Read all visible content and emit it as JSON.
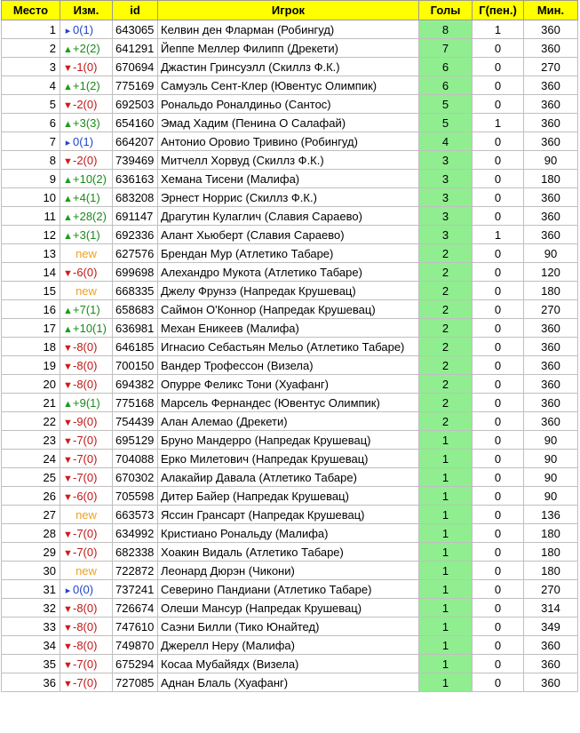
{
  "table": {
    "headers": {
      "rank": "Место",
      "change": "Изм.",
      "id": "id",
      "player": "Игрок",
      "goals": "Голы",
      "pen": "Г(пен.)",
      "min": "Мин."
    },
    "rows": [
      {
        "rank": "1",
        "dir": "same",
        "change": "0(1)",
        "id": "643065",
        "player": "Келвин ден Фларман (Робингуд)",
        "goals": "8",
        "pen": "1",
        "min": "360"
      },
      {
        "rank": "2",
        "dir": "up",
        "change": "+2(2)",
        "id": "641291",
        "player": "Йеппе Меллер Филипп (Дрекети)",
        "goals": "7",
        "pen": "0",
        "min": "360"
      },
      {
        "rank": "3",
        "dir": "down",
        "change": "-1(0)",
        "id": "670694",
        "player": "Джастин Гринсуэлл (Скиллз Ф.К.)",
        "goals": "6",
        "pen": "0",
        "min": "270"
      },
      {
        "rank": "4",
        "dir": "up",
        "change": "+1(2)",
        "id": "775169",
        "player": "Самуэль Сент-Клер (Ювентус Олимпик)",
        "goals": "6",
        "pen": "0",
        "min": "360"
      },
      {
        "rank": "5",
        "dir": "down",
        "change": "-2(0)",
        "id": "692503",
        "player": "Рональдо Роналдиньо (Сантос)",
        "goals": "5",
        "pen": "0",
        "min": "360"
      },
      {
        "rank": "6",
        "dir": "up",
        "change": "+3(3)",
        "id": "654160",
        "player": "Эмад Хадим (Пенина О Салафай)",
        "goals": "5",
        "pen": "1",
        "min": "360"
      },
      {
        "rank": "7",
        "dir": "same",
        "change": "0(1)",
        "id": "664207",
        "player": "Антонио Оровио Тривино (Робингуд)",
        "goals": "4",
        "pen": "0",
        "min": "360"
      },
      {
        "rank": "8",
        "dir": "down",
        "change": "-2(0)",
        "id": "739469",
        "player": "Митчелл Хорвуд (Скиллз Ф.К.)",
        "goals": "3",
        "pen": "0",
        "min": "90"
      },
      {
        "rank": "9",
        "dir": "up",
        "change": "+10(2)",
        "id": "636163",
        "player": "Хемана Тисени (Малифа)",
        "goals": "3",
        "pen": "0",
        "min": "180"
      },
      {
        "rank": "10",
        "dir": "up",
        "change": "+4(1)",
        "id": "683208",
        "player": "Эрнест Норрис (Скиллз Ф.К.)",
        "goals": "3",
        "pen": "0",
        "min": "360"
      },
      {
        "rank": "11",
        "dir": "up",
        "change": "+28(2)",
        "id": "691147",
        "player": "Драгутин Кулаглич (Славия Сараево)",
        "goals": "3",
        "pen": "0",
        "min": "360"
      },
      {
        "rank": "12",
        "dir": "up",
        "change": "+3(1)",
        "id": "692336",
        "player": "Алант Хьюберт (Славия Сараево)",
        "goals": "3",
        "pen": "1",
        "min": "360"
      },
      {
        "rank": "13",
        "dir": "new",
        "change": "new",
        "id": "627576",
        "player": "Брендан Мур (Атлетико Табаре)",
        "goals": "2",
        "pen": "0",
        "min": "90"
      },
      {
        "rank": "14",
        "dir": "down",
        "change": "-6(0)",
        "id": "699698",
        "player": "Алехандро Мукота (Атлетико Табаре)",
        "goals": "2",
        "pen": "0",
        "min": "120"
      },
      {
        "rank": "15",
        "dir": "new",
        "change": "new",
        "id": "668335",
        "player": "Джелу Фрунзэ (Напредак Крушевац)",
        "goals": "2",
        "pen": "0",
        "min": "180"
      },
      {
        "rank": "16",
        "dir": "up",
        "change": "+7(1)",
        "id": "658683",
        "player": "Саймон О'Коннор (Напредак Крушевац)",
        "goals": "2",
        "pen": "0",
        "min": "270"
      },
      {
        "rank": "17",
        "dir": "up",
        "change": "+10(1)",
        "id": "636981",
        "player": "Механ Еникеев (Малифа)",
        "goals": "2",
        "pen": "0",
        "min": "360"
      },
      {
        "rank": "18",
        "dir": "down",
        "change": "-8(0)",
        "id": "646185",
        "player": "Игнасио Себастьян Мельо (Атлетико Табаре)",
        "goals": "2",
        "pen": "0",
        "min": "360"
      },
      {
        "rank": "19",
        "dir": "down",
        "change": "-8(0)",
        "id": "700150",
        "player": "Вандер Трофессон (Визела)",
        "goals": "2",
        "pen": "0",
        "min": "360"
      },
      {
        "rank": "20",
        "dir": "down",
        "change": "-8(0)",
        "id": "694382",
        "player": "Опурре Феликс Тони (Хуафанг)",
        "goals": "2",
        "pen": "0",
        "min": "360"
      },
      {
        "rank": "21",
        "dir": "up",
        "change": "+9(1)",
        "id": "775168",
        "player": "Марсель Фернандес (Ювентус Олимпик)",
        "goals": "2",
        "pen": "0",
        "min": "360"
      },
      {
        "rank": "22",
        "dir": "down",
        "change": "-9(0)",
        "id": "754439",
        "player": "Алан Алемао (Дрекети)",
        "goals": "2",
        "pen": "0",
        "min": "360"
      },
      {
        "rank": "23",
        "dir": "down",
        "change": "-7(0)",
        "id": "695129",
        "player": "Бруно Мандерро (Напредак Крушевац)",
        "goals": "1",
        "pen": "0",
        "min": "90"
      },
      {
        "rank": "24",
        "dir": "down",
        "change": "-7(0)",
        "id": "704088",
        "player": "Ерко Милетович (Напредак Крушевац)",
        "goals": "1",
        "pen": "0",
        "min": "90"
      },
      {
        "rank": "25",
        "dir": "down",
        "change": "-7(0)",
        "id": "670302",
        "player": "Алакайир Давала (Атлетико Табаре)",
        "goals": "1",
        "pen": "0",
        "min": "90"
      },
      {
        "rank": "26",
        "dir": "down",
        "change": "-6(0)",
        "id": "705598",
        "player": "Дитер Байер (Напредак Крушевац)",
        "goals": "1",
        "pen": "0",
        "min": "90"
      },
      {
        "rank": "27",
        "dir": "new",
        "change": "new",
        "id": "663573",
        "player": "Яссин Грансарт (Напредак Крушевац)",
        "goals": "1",
        "pen": "0",
        "min": "136"
      },
      {
        "rank": "28",
        "dir": "down",
        "change": "-7(0)",
        "id": "634992",
        "player": "Кристиано Рональду (Малифа)",
        "goals": "1",
        "pen": "0",
        "min": "180"
      },
      {
        "rank": "29",
        "dir": "down",
        "change": "-7(0)",
        "id": "682338",
        "player": "Хоакин Видаль (Атлетико Табаре)",
        "goals": "1",
        "pen": "0",
        "min": "180"
      },
      {
        "rank": "30",
        "dir": "new",
        "change": "new",
        "id": "722872",
        "player": "Леонард Дюрэн (Чикони)",
        "goals": "1",
        "pen": "0",
        "min": "180"
      },
      {
        "rank": "31",
        "dir": "same",
        "change": "0(0)",
        "id": "737241",
        "player": "Северино Пандиани (Атлетико Табаре)",
        "goals": "1",
        "pen": "0",
        "min": "270"
      },
      {
        "rank": "32",
        "dir": "down",
        "change": "-8(0)",
        "id": "726674",
        "player": "Олеши Мансур (Напредак Крушевац)",
        "goals": "1",
        "pen": "0",
        "min": "314"
      },
      {
        "rank": "33",
        "dir": "down",
        "change": "-8(0)",
        "id": "747610",
        "player": "Саэни Билли (Тико Юнайтед)",
        "goals": "1",
        "pen": "0",
        "min": "349"
      },
      {
        "rank": "34",
        "dir": "down",
        "change": "-8(0)",
        "id": "749870",
        "player": "Джерелл Неру (Малифа)",
        "goals": "1",
        "pen": "0",
        "min": "360"
      },
      {
        "rank": "35",
        "dir": "down",
        "change": "-7(0)",
        "id": "675294",
        "player": "Косаа Мубайядх (Визела)",
        "goals": "1",
        "pen": "0",
        "min": "360"
      },
      {
        "rank": "36",
        "dir": "down",
        "change": "-7(0)",
        "id": "727085",
        "player": "Аднан Блаль (Хуафанг)",
        "goals": "1",
        "pen": "0",
        "min": "360"
      }
    ]
  }
}
